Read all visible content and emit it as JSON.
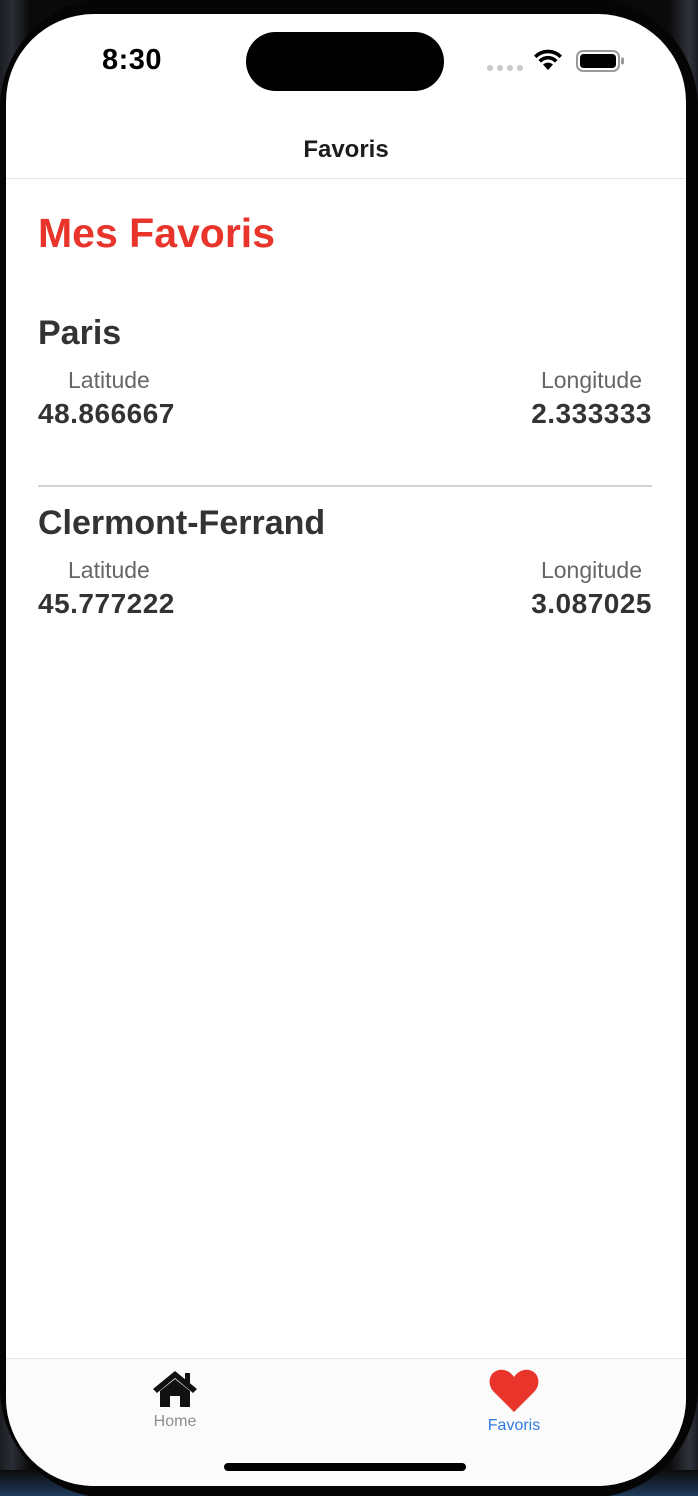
{
  "status_bar": {
    "time": "8:30"
  },
  "nav": {
    "title": "Favoris"
  },
  "page": {
    "title": "Mes Favoris",
    "accent_color": "#e8342a"
  },
  "favorites": [
    {
      "city": "Paris",
      "latitude_label": "Latitude",
      "latitude": "48.866667",
      "longitude_label": "Longitude",
      "longitude": "2.333333"
    },
    {
      "city": "Clermont-Ferrand",
      "latitude_label": "Latitude",
      "latitude": "45.777222",
      "longitude_label": "Longitude",
      "longitude": "3.087025"
    }
  ],
  "tab_bar": {
    "items": [
      {
        "label": "Home",
        "icon": "home-icon",
        "active": false
      },
      {
        "label": "Favoris",
        "icon": "heart-icon",
        "active": true
      }
    ],
    "active_color": "#2f7ce0",
    "inactive_color": "#8e8e93"
  }
}
